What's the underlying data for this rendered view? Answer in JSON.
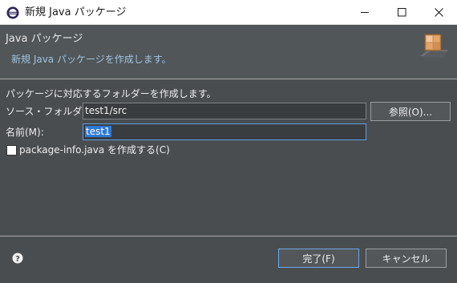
{
  "window": {
    "title": "新規 Java パッケージ",
    "icon": "eclipse-icon"
  },
  "header": {
    "title": "Java パッケージ",
    "message": "新規 Java パッケージを作成します。",
    "banner_icon": "new-package-wizard-banner"
  },
  "body": {
    "description": "パッケージに対応するフォルダーを作成します。",
    "source_folder": {
      "label": "ソース・フォルダー(D):",
      "value": "test1/src",
      "browse_label": "参照(O)..."
    },
    "name": {
      "label": "名前(M):",
      "value": "test1"
    },
    "create_package_info": {
      "label": "package-info.java を作成する(C)",
      "checked": false
    }
  },
  "footer": {
    "finish_label": "完了(F)",
    "cancel_label": "キャンセル",
    "help_icon": "help-icon"
  },
  "colors": {
    "dialog_background": "#4a4d50",
    "header_background": "#515658",
    "message_text": "#9fc3e2",
    "selection": "#2f7ad6",
    "focus_border": "#5aa0e6"
  }
}
